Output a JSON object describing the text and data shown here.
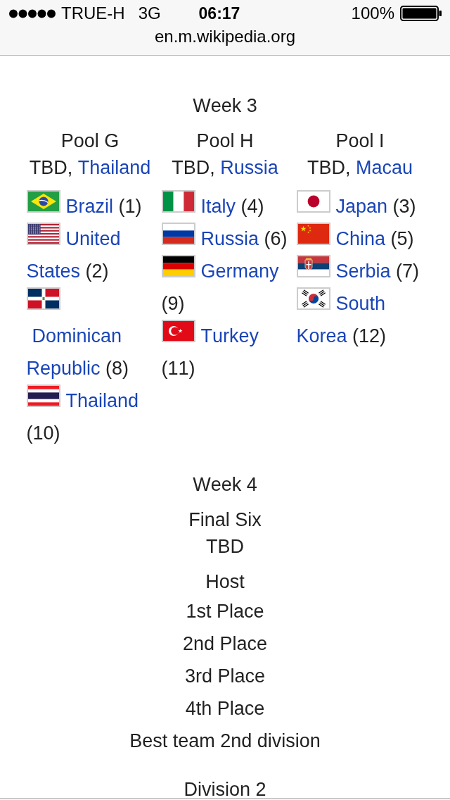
{
  "status_bar": {
    "carrier": "TRUE-H",
    "network": "3G",
    "time": "06:17",
    "battery": "100%"
  },
  "address_bar": {
    "url": "en.m.wikipedia.org"
  },
  "weeks": [
    {
      "title": "Week 3",
      "pools": [
        {
          "name": "Pool G",
          "host": {
            "text": "TBD,",
            "link": "Thailand"
          },
          "teams": [
            {
              "kind": "brazil",
              "name": "Brazil",
              "seed": "(1)"
            },
            {
              "kind": "usa",
              "name": "United States",
              "seed": "(2)"
            },
            {
              "kind": "dominican",
              "name": "Dominican Republic",
              "seed": "(8)"
            },
            {
              "kind": "thailand",
              "name": "Thailand",
              "seed": "(10)"
            }
          ]
        },
        {
          "name": "Pool H",
          "host": {
            "text": "TBD,",
            "link": "Russia"
          },
          "teams": [
            {
              "kind": "italy",
              "name": "Italy",
              "seed": "(4)"
            },
            {
              "kind": "russia",
              "name": "Russia",
              "seed": "(6)"
            },
            {
              "kind": "germany",
              "name": "Germany",
              "seed": "(9)"
            },
            {
              "kind": "turkey",
              "name": "Turkey",
              "seed": "(11)"
            }
          ]
        },
        {
          "name": "Pool I",
          "host": {
            "text": "TBD,",
            "link": "Macau"
          },
          "teams": [
            {
              "kind": "japan",
              "name": "Japan",
              "seed": "(3)"
            },
            {
              "kind": "china",
              "name": "China",
              "seed": "(5)"
            },
            {
              "kind": "serbia",
              "name": "Serbia",
              "seed": "(7)"
            },
            {
              "kind": "korea",
              "name": "South Korea",
              "seed": "(12)"
            }
          ]
        }
      ]
    },
    {
      "title": "Week 4",
      "pools": [
        {
          "name": "Final Six",
          "host": {
            "text": "TBD"
          }
        }
      ],
      "standings": {
        "heading": "Host",
        "places": [
          "1st Place",
          "2nd Place",
          "3rd Place",
          "4th Place",
          "Best team 2nd division"
        ]
      }
    }
  ],
  "next_section": {
    "title": "Division 2"
  }
}
